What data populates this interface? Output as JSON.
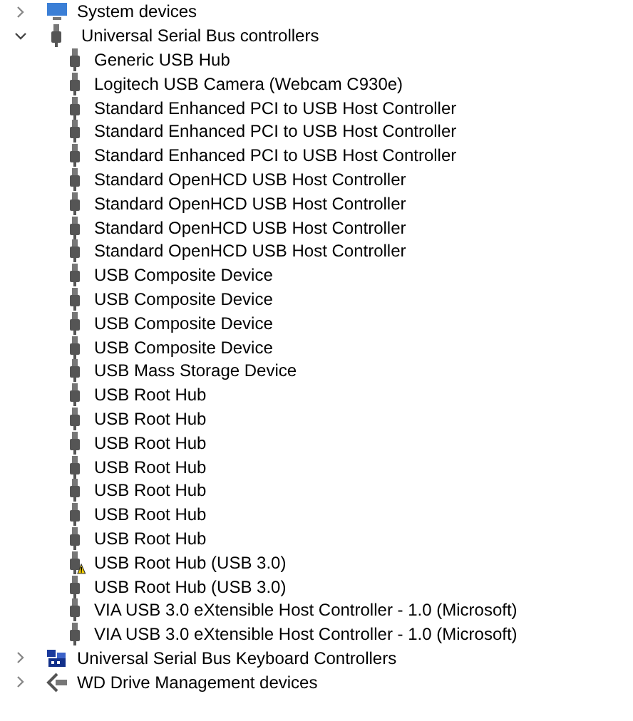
{
  "tree": [
    {
      "label": "System devices",
      "kind": "system",
      "expanded": false
    },
    {
      "label": "Universal Serial Bus controllers",
      "kind": "usb",
      "expanded": true,
      "children": [
        {
          "label": "Generic USB Hub",
          "warning": false
        },
        {
          "label": "Logitech USB Camera (Webcam C930e)",
          "warning": false
        },
        {
          "label": "Standard Enhanced PCI to USB Host Controller",
          "warning": false
        },
        {
          "label": "Standard Enhanced PCI to USB Host Controller",
          "warning": false
        },
        {
          "label": "Standard Enhanced PCI to USB Host Controller",
          "warning": false
        },
        {
          "label": "Standard OpenHCD USB Host Controller",
          "warning": false
        },
        {
          "label": "Standard OpenHCD USB Host Controller",
          "warning": false
        },
        {
          "label": "Standard OpenHCD USB Host Controller",
          "warning": false
        },
        {
          "label": "Standard OpenHCD USB Host Controller",
          "warning": false
        },
        {
          "label": "USB Composite Device",
          "warning": false
        },
        {
          "label": "USB Composite Device",
          "warning": false
        },
        {
          "label": "USB Composite Device",
          "warning": false
        },
        {
          "label": "USB Composite Device",
          "warning": false
        },
        {
          "label": "USB Mass Storage Device",
          "warning": false
        },
        {
          "label": "USB Root Hub",
          "warning": false
        },
        {
          "label": "USB Root Hub",
          "warning": false
        },
        {
          "label": "USB Root Hub",
          "warning": false
        },
        {
          "label": "USB Root Hub",
          "warning": false
        },
        {
          "label": "USB Root Hub",
          "warning": false
        },
        {
          "label": "USB Root Hub",
          "warning": false
        },
        {
          "label": "USB Root Hub",
          "warning": false
        },
        {
          "label": "USB Root Hub (USB 3.0)",
          "warning": true
        },
        {
          "label": "USB Root Hub (USB 3.0)",
          "warning": false
        },
        {
          "label": "VIA USB 3.0 eXtensible Host Controller - 1.0 (Microsoft)",
          "warning": false
        },
        {
          "label": "VIA USB 3.0 eXtensible Host Controller - 1.0 (Microsoft)",
          "warning": false
        }
      ]
    },
    {
      "label": "Universal Serial Bus Keyboard Controllers",
      "kind": "keyboard",
      "expanded": false
    },
    {
      "label": "WD Drive Management devices",
      "kind": "drive",
      "expanded": false
    }
  ]
}
